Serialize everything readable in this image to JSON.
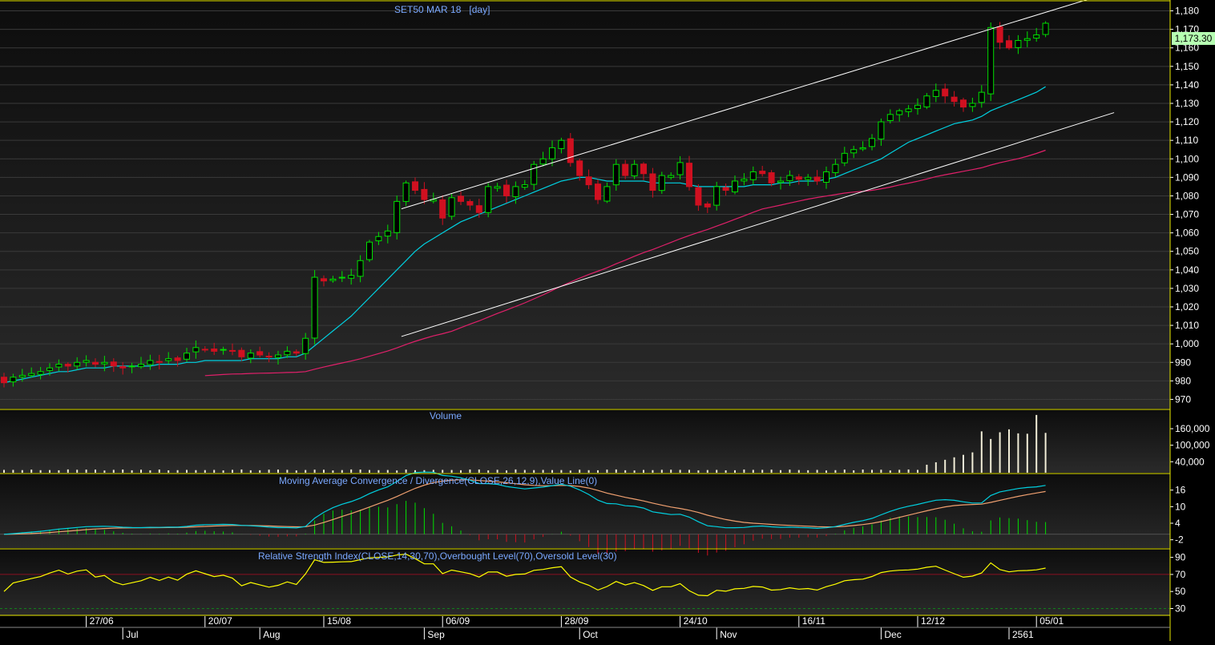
{
  "chart_data": [
    {
      "type": "candlestick",
      "title": "SET50 MAR 18",
      "period_label": "[day]",
      "last_value_label": "1,173.30",
      "ylim": [
        965,
        1185
      ],
      "y_ticks": [
        970,
        980,
        990,
        1000,
        1010,
        1020,
        1030,
        1040,
        1050,
        1060,
        1070,
        1080,
        1090,
        1100,
        1110,
        1120,
        1130,
        1140,
        1150,
        1160,
        1170,
        1180
      ],
      "y_tick_labels": [
        "970",
        "980",
        "990",
        "1,000",
        "1,010",
        "1,020",
        "1,030",
        "1,040",
        "1,050",
        "1,060",
        "1,070",
        "1,080",
        "1,090",
        "1,100",
        "1,110",
        "1,120",
        "1,130",
        "1,140",
        "1,150",
        "1,160",
        "1,170",
        "1,180"
      ],
      "close": [
        979,
        982,
        983,
        984,
        985,
        987,
        989,
        988,
        990,
        991,
        989,
        990,
        988,
        987,
        988,
        989,
        991,
        990,
        992,
        991,
        995,
        998,
        997,
        996,
        997,
        996,
        993,
        995,
        994,
        993,
        994,
        996,
        995,
        1003,
        1036,
        1034,
        1035,
        1036,
        1037,
        1045,
        1055,
        1058,
        1061,
        1077,
        1087,
        1083,
        1078,
        1078,
        1068,
        1079,
        1077,
        1075,
        1071,
        1085,
        1085,
        1080,
        1085,
        1086,
        1097,
        1100,
        1106,
        1110,
        1098,
        1091,
        1086,
        1078,
        1085,
        1097,
        1091,
        1097,
        1092,
        1083,
        1091,
        1091,
        1098,
        1085,
        1075,
        1074,
        1085,
        1083,
        1088,
        1089,
        1093,
        1092,
        1087,
        1088,
        1091,
        1089,
        1090,
        1088,
        1093,
        1097,
        1103,
        1105,
        1106,
        1111,
        1120,
        1124,
        1126,
        1127,
        1129,
        1134,
        1137,
        1134,
        1131,
        1128,
        1130,
        1136,
        1171,
        1163,
        1160,
        1164,
        1165,
        1167,
        1173.3
      ],
      "sma_fast": [
        979,
        980,
        981,
        982,
        983,
        984,
        985,
        985,
        986,
        987,
        987,
        987,
        988,
        988,
        988,
        988,
        988,
        989,
        989,
        989,
        990,
        990,
        991,
        991,
        991,
        991,
        991,
        992,
        992,
        992,
        992,
        993,
        993,
        995,
        999,
        1003,
        1007,
        1011,
        1015,
        1020,
        1025,
        1030,
        1035,
        1040,
        1045,
        1050,
        1054,
        1057,
        1060,
        1063,
        1066,
        1068,
        1070,
        1072,
        1074,
        1076,
        1078,
        1080,
        1082,
        1084,
        1086,
        1088,
        1089,
        1090,
        1090,
        1089,
        1088,
        1088,
        1088,
        1088,
        1088,
        1087,
        1087,
        1087,
        1087,
        1086,
        1085,
        1085,
        1085,
        1085,
        1085,
        1085,
        1086,
        1086,
        1086,
        1087,
        1087,
        1088,
        1088,
        1088,
        1089,
        1090,
        1092,
        1094,
        1096,
        1098,
        1100,
        1103,
        1106,
        1109,
        1111,
        1113,
        1115,
        1117,
        1119,
        1120,
        1121,
        1123,
        1126,
        1128,
        1130,
        1132,
        1134,
        1136,
        1139
      ],
      "sma_slow": [
        null,
        null,
        null,
        null,
        null,
        null,
        null,
        null,
        null,
        null,
        null,
        null,
        null,
        null,
        null,
        null,
        null,
        null,
        null,
        null,
        null,
        null,
        null,
        null,
        null,
        null,
        null,
        null,
        null,
        null,
        null,
        null,
        null,
        null,
        null,
        null,
        null,
        null,
        null,
        null,
        null,
        null,
        null,
        null,
        null,
        null,
        null,
        null,
        null,
        null,
        null,
        null,
        null,
        null,
        null,
        null,
        null,
        null,
        null,
        null,
        null,
        null,
        null,
        null,
        null,
        null,
        null,
        null,
        null,
        null,
        null,
        null,
        null,
        null,
        null,
        null,
        null,
        null,
        null,
        null,
        null,
        null,
        null,
        null,
        null,
        null,
        null,
        null,
        null,
        null,
        null,
        null,
        null,
        null,
        null,
        null,
        null,
        null,
        null,
        null,
        null,
        null,
        null,
        null,
        null,
        null,
        null,
        null,
        null,
        null,
        null,
        null,
        null,
        null,
        null
      ],
      "trendlines": [
        {
          "from": [
            43.5,
            1073
          ],
          "to": [
            120.5,
            1189
          ]
        },
        {
          "from": [
            43.5,
            1004
          ],
          "to": [
            121.5,
            1125
          ]
        }
      ]
    },
    {
      "type": "bar",
      "title": "Volume",
      "y_tick_labels": [
        "160,000",
        "100,000",
        "40,000"
      ],
      "y_ticks": [
        160000,
        100000,
        40000
      ],
      "ylim": [
        0,
        230000
      ]
    },
    {
      "type": "line",
      "title": "Moving Average Convergence / Divergence(CLOSE,26,12,9),Value Line(0)",
      "y_tick_labels": [
        "16",
        "10",
        "4",
        "-2"
      ],
      "y_ticks": [
        16,
        10,
        4,
        -2
      ],
      "ylim": [
        -5,
        22
      ]
    },
    {
      "type": "line",
      "title": "Relative Strength Index(CLOSE,14,30,70),Overbought Level(70),Oversold Level(30)",
      "y_tick_labels": [
        "90",
        "70",
        "50",
        "30"
      ],
      "y_ticks": [
        90,
        70,
        50,
        30
      ],
      "ylim": [
        22,
        100
      ],
      "overbought": 70,
      "oversold": 30
    }
  ],
  "x_axis": {
    "top_labels": [
      {
        "label": "27/06",
        "bar": 9
      },
      {
        "label": "20/07",
        "bar": 22
      },
      {
        "label": "15/08",
        "bar": 35
      },
      {
        "label": "06/09",
        "bar": 48
      },
      {
        "label": "28/09",
        "bar": 61
      },
      {
        "label": "24/10",
        "bar": 74
      },
      {
        "label": "16/11",
        "bar": 87
      },
      {
        "label": "12/12",
        "bar": 100
      },
      {
        "label": "05/01",
        "bar": 113
      }
    ],
    "bottom_labels": [
      {
        "label": "Jul",
        "bar": 13
      },
      {
        "label": "Aug",
        "bar": 28
      },
      {
        "label": "Sep",
        "bar": 46
      },
      {
        "label": "Oct",
        "bar": 63
      },
      {
        "label": "Nov",
        "bar": 78
      },
      {
        "label": "Dec",
        "bar": 96
      },
      {
        "label": "2561",
        "bar": 110
      }
    ]
  },
  "colors": {
    "up": "#00e000",
    "down": "#d01020",
    "sma_fast": "#00d0e0",
    "sma_slow": "#e0206a",
    "trend": "#ffffff",
    "volume": "#f2eed8",
    "macd": "#00d0e0",
    "signal": "#f0a070",
    "rsi": "#ffff00",
    "separator": "#e8e800",
    "title": "#7aa8ff"
  }
}
